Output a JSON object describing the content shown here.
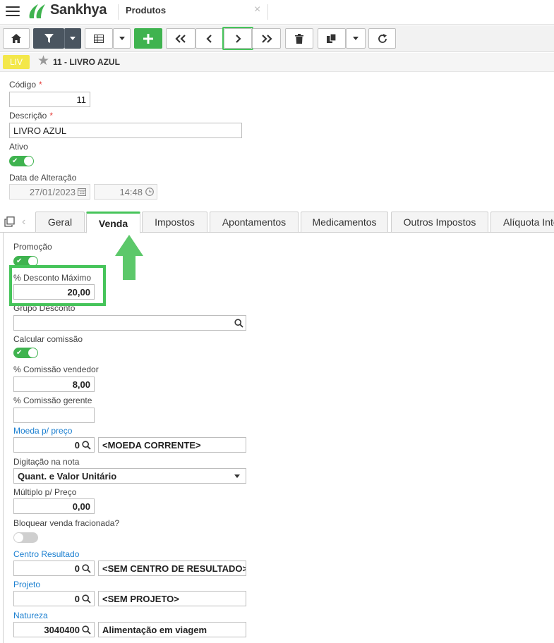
{
  "app": {
    "brand": "Sankhya",
    "tab_title": "Produtos",
    "tab_close": "×"
  },
  "record": {
    "badge": "LIV",
    "title": "11 - LIVRO AZUL"
  },
  "header_form": {
    "codigo": {
      "label": "Código",
      "value": "11"
    },
    "descricao": {
      "label": "Descrição",
      "value": "LIVRO AZUL"
    },
    "ativo": {
      "label": "Ativo",
      "on": true
    },
    "data_alteracao": {
      "label": "Data de Alteração",
      "date": "27/01/2023",
      "time": "14:48"
    }
  },
  "tabs": [
    "Geral",
    "Venda",
    "Impostos",
    "Apontamentos",
    "Medicamentos",
    "Outros Impostos",
    "Alíquota Inte"
  ],
  "active_tab": "Venda",
  "venda": {
    "promocao": {
      "label": "Promoção",
      "on": true
    },
    "desconto_maximo": {
      "label": "% Desconto Máximo",
      "value": "20,00"
    },
    "grupo_desconto": {
      "label": "Grupo Desconto",
      "value": ""
    },
    "calcular_comissao": {
      "label": "Calcular comissão",
      "on": true
    },
    "comissao_vendedor": {
      "label": "% Comissão vendedor",
      "value": "8,00"
    },
    "comissao_gerente": {
      "label": "% Comissão gerente",
      "value": ""
    },
    "moeda": {
      "label": "Moeda p/ preço",
      "code": "0",
      "desc": "<MOEDA CORRENTE>"
    },
    "digitacao": {
      "label": "Digitação na nota",
      "value": "Quant. e Valor Unitário"
    },
    "multiplo": {
      "label": "Múltiplo p/ Preço",
      "value": "0,00"
    },
    "bloquear": {
      "label": "Bloquear venda fracionada?",
      "on": false
    },
    "centro_resultado": {
      "label": "Centro Resultado",
      "code": "0",
      "desc": "<SEM CENTRO DE RESULTADO>"
    },
    "projeto": {
      "label": "Projeto",
      "code": "0",
      "desc": "<SEM PROJETO>"
    },
    "natureza": {
      "label": "Natureza",
      "code": "3040400",
      "desc": "Alimentação em viagem"
    }
  },
  "colors": {
    "accent_green": "#46c45a",
    "button_green": "#3fb34f",
    "link_blue": "#1b7fd0",
    "badge_yellow": "#f3e74a",
    "dark_button": "#4a5560"
  }
}
